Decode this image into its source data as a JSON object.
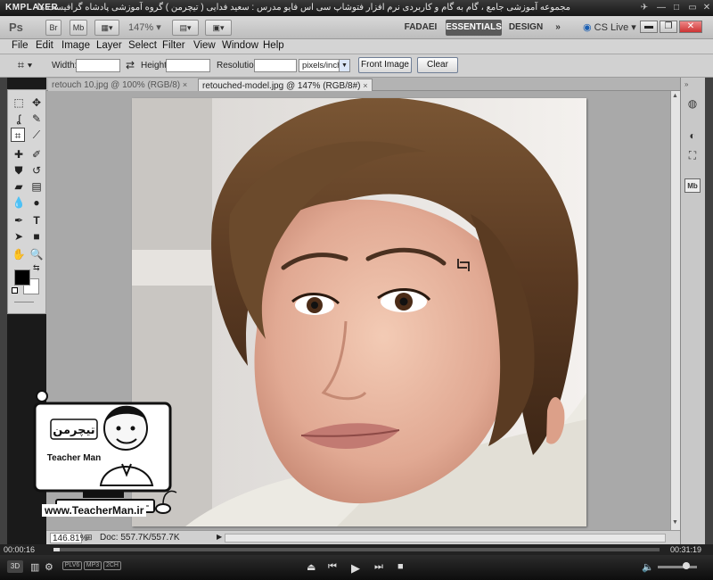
{
  "km": {
    "logo": "KMPLAYER",
    "caption": "مجموعه آموزشی جامع ، گام به گام و کاربردی نرم افزار فتوشاپ سی اس فایو  مدرس : سعید فدایی ( تیچرمن ) گروه آموزشی پادشاه گرافیست ها",
    "time_current": "00:00:16",
    "time_total": "00:31:19",
    "badges": [
      "PLV6",
      "MP3",
      "2CH"
    ],
    "mode": "3D"
  },
  "app": {
    "logo": "Ps",
    "br": "Br",
    "mb": "Mb",
    "zoom": "147%",
    "workspaces": [
      "FADAEI",
      "ESSENTIALS",
      "DESIGN"
    ],
    "more": "»",
    "cslive": "CS Live"
  },
  "menu": [
    "File",
    "Edit",
    "Image",
    "Layer",
    "Select",
    "Filter",
    "View",
    "Window",
    "Help"
  ],
  "options": {
    "width_label": "Width:",
    "height_label": "Height:",
    "resolution_label": "Resolution:",
    "units": "pixels/inch",
    "front_image": "Front Image",
    "clear": "Clear"
  },
  "tabs": [
    {
      "label": "retouch 10.jpg @ 100% (RGB/8)",
      "close": "×"
    },
    {
      "label": "retouched-model.jpg @ 147% (RGB/8#)",
      "close": "×"
    }
  ],
  "status": {
    "zoom": "146.81%",
    "doc": "Doc: 557.7K/557.7K"
  },
  "watermark": {
    "brand": "تیچرمن",
    "sub": "Teacher Man",
    "url": "www.TeacherMan.ir"
  },
  "colors": {
    "accent": "#5a5a5a",
    "fg": "#000000",
    "bg": "#ffffff"
  }
}
